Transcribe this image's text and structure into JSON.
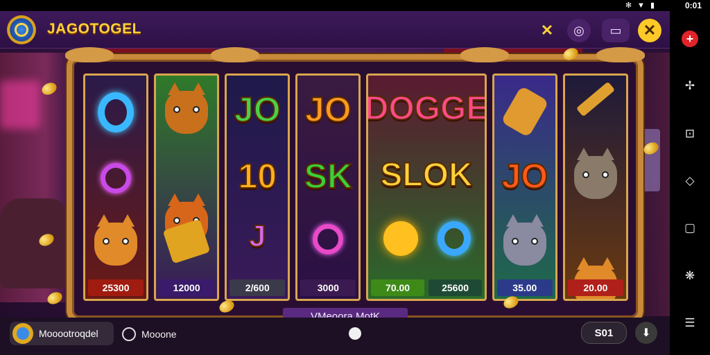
{
  "status": {
    "time": "0:01",
    "icons": [
      "settings-icon",
      "wifi-icon",
      "battery-icon"
    ]
  },
  "header": {
    "title": "JAGOTOGEL",
    "buttons": [
      "shuffle-icon",
      "sync-icon",
      "screen-icon",
      "close-icon"
    ]
  },
  "reels": {
    "labels": [
      "JO",
      "JO",
      "DOGGE",
      "10",
      "SK",
      "SLOK",
      "JO"
    ],
    "values": [
      {
        "text": "25300",
        "color": "#a01c10"
      },
      {
        "text": "12000",
        "color": "#3a1a6a"
      },
      {
        "text": "2/600",
        "color": "#3a3a4a"
      },
      {
        "text": "3000",
        "color": "#3a1a50"
      },
      {
        "text": "70.00",
        "color": "#3e8a18"
      },
      {
        "text": "25600",
        "color": "#1e4a34"
      },
      {
        "text": "35.00",
        "color": "#2c3a8a"
      },
      {
        "text": "20.00",
        "color": "#b0201a"
      }
    ]
  },
  "mode_label": "VMeoora MotK",
  "bottom": {
    "player_label": "Mooootroqdel",
    "mode_label": "Mooone",
    "bet_value": "S01"
  },
  "nav": [
    "add-icon",
    "pin-icon",
    "frame-icon",
    "chat-icon",
    "copy-icon",
    "shield-icon",
    "list-icon"
  ],
  "colors": {
    "accent": "#ffd23a",
    "frame": "#c7893a",
    "close": "#e0242a"
  }
}
